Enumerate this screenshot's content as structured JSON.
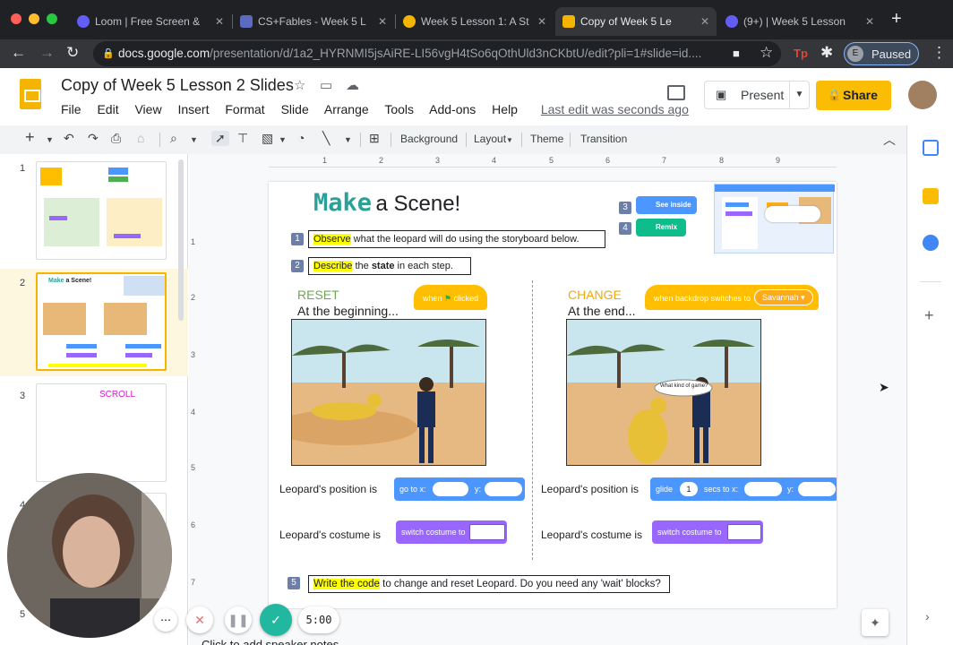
{
  "browser": {
    "tabs": [
      {
        "title": "Loom | Free Screen &",
        "color": "#625df5"
      },
      {
        "title": "CS+Fables - Week 5 L",
        "color": "#5c6bc0"
      },
      {
        "title": "Week 5 Lesson 1: A St",
        "color": "#f4b400"
      },
      {
        "title": "Copy of Week 5 Le",
        "color": "#f4b400",
        "active": true
      },
      {
        "title": "(9+) | Week 5 Lesson",
        "color": "#625df5"
      }
    ],
    "url_host": "docs.google.com",
    "url_path": "/presentation/d/1a2_HYRNMI5jsAiRE-LI56vgH4tSo6qOthUld3nCKbtU/edit?pli=1#slide=id....",
    "profile_initial": "E",
    "profile_status": "Paused"
  },
  "app": {
    "doc_title": "Copy of Week 5 Lesson 2 Slides",
    "menu": [
      "File",
      "Edit",
      "View",
      "Insert",
      "Format",
      "Slide",
      "Arrange",
      "Tools",
      "Add-ons",
      "Help"
    ],
    "last_edit": "Last edit was seconds ago",
    "present_label": "Present",
    "share_label": "Share"
  },
  "toolbar": {
    "background": "Background",
    "layout": "Layout",
    "theme": "Theme",
    "transition": "Transition"
  },
  "filmstrip": {
    "items": [
      {
        "num": "1"
      },
      {
        "num": "2",
        "selected": true
      },
      {
        "num": "3",
        "text": "SCROLL"
      },
      {
        "num": "4"
      },
      {
        "num": "5"
      }
    ]
  },
  "ruler": {
    "h_ticks": [
      "1",
      "2",
      "3",
      "4",
      "5",
      "6",
      "7",
      "8",
      "9"
    ],
    "v_ticks": [
      "1",
      "2",
      "3",
      "4",
      "5",
      "6",
      "7"
    ]
  },
  "slide": {
    "title_make": "Make",
    "title_rest": "a Scene!",
    "step1_num": "1",
    "step1_hl": "Observe",
    "step1_rest": " what the leopard will do using the storyboard below.",
    "step2_num": "2",
    "step2_hl": "Describe",
    "step2_mid": " the ",
    "step2_bold": "state",
    "step2_rest": " in each step.",
    "step3_num": "3",
    "step4_num": "4",
    "see_inside": "See inside",
    "remix": "Remix",
    "reset_title": "RESET",
    "reset_sub": "At the beginning...",
    "change_title": "CHANGE",
    "change_sub": "At the end...",
    "hat_when": "when",
    "hat_clicked": "clicked",
    "hat_backdrop": "when backdrop switches to",
    "hat_backdrop_value": "Savannah",
    "speech_bubble": "What kind of game?",
    "pos_label": "Leopard's position is",
    "costume_label": "Leopard's costume is",
    "goto_label": "go to x:",
    "y_label": "y:",
    "glide_label": "glide",
    "glide_secs": "1",
    "secs_to_x": "secs to x:",
    "switch_costume": "switch costume to",
    "step5_num": "5",
    "step5_hl": "Write the code",
    "step5_rest": " to change and reset Leopard. Do you need any 'wait' blocks?"
  },
  "recorder": {
    "timer": "5:00"
  },
  "speaker_notes": "Click to add speaker notes"
}
